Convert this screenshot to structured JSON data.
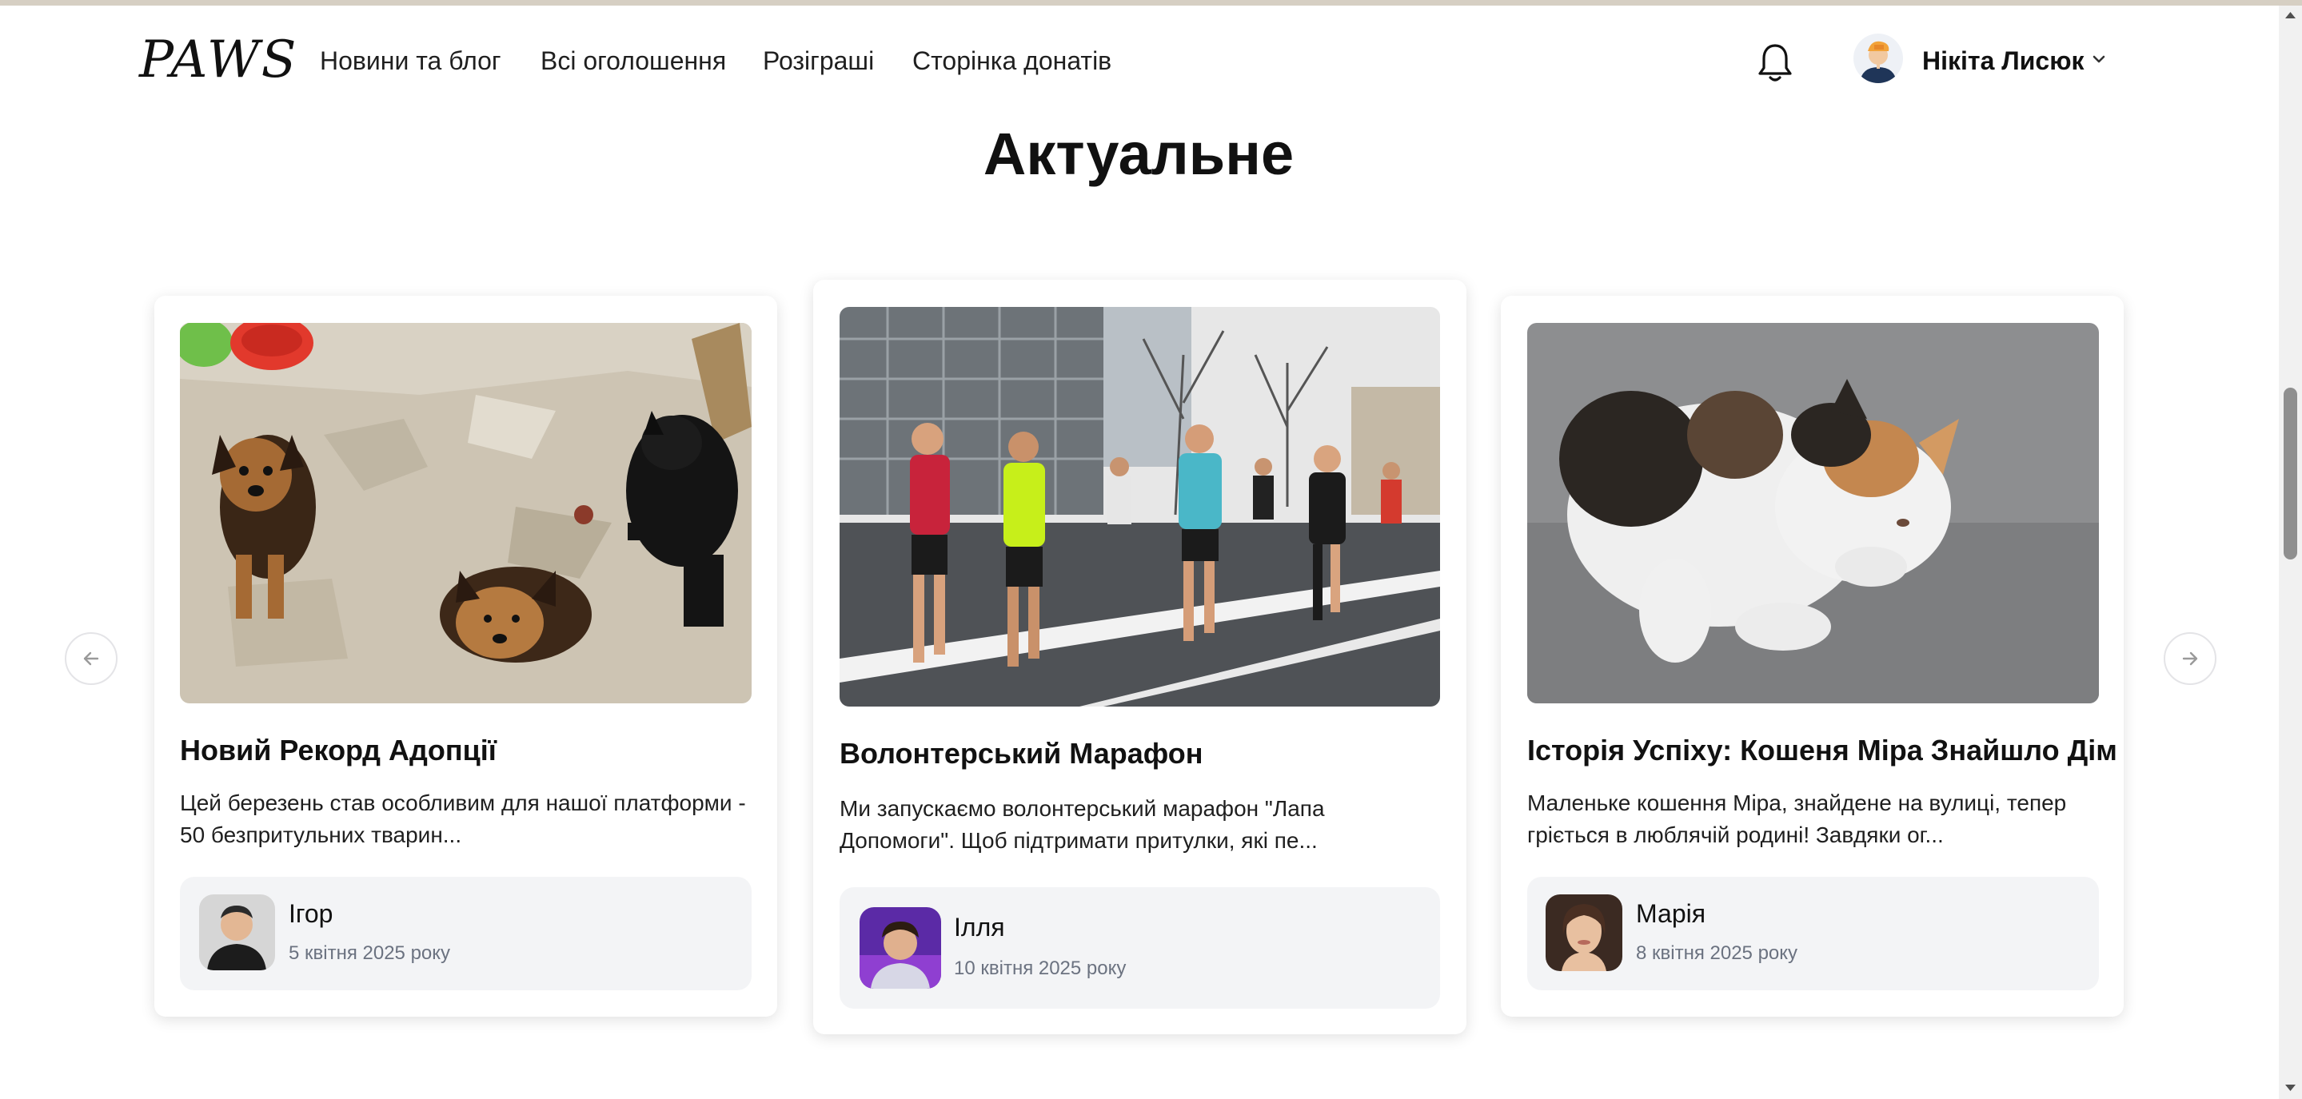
{
  "header": {
    "logo": "PAWS",
    "nav": [
      {
        "label": "Новини та блог"
      },
      {
        "label": "Всі оголошення"
      },
      {
        "label": "Розіграші"
      },
      {
        "label": "Сторінка донатів"
      }
    ],
    "user_name": "Нікіта Лисюк"
  },
  "section_title": "Актуальне",
  "cards": [
    {
      "title": "Новий Рекорд Адопції",
      "excerpt": "Цей березень став особливим для нашої платформи - 50 безпритульних тварин...",
      "author": "Ігор",
      "date": "5 квітня 2025 року",
      "image": "dogs-photo"
    },
    {
      "title": "Волонтерський Марафон",
      "excerpt": "Ми запускаємо волонтерський марафон \"Лапа Допомоги\". Щоб підтримати притулки, які пе...",
      "author": "Ілля",
      "date": "10 квітня 2025 року",
      "image": "marathon-photo"
    },
    {
      "title": "Історія Успіху: Кошеня Міра Знайшло Дім",
      "excerpt": "Маленьке кошення Міра, знайдене на вулиці, тепер гріється в люблячій родині! Завдяки ог...",
      "author": "Марія",
      "date": "8 квітня 2025 року",
      "image": "kitten-photo"
    }
  ],
  "icons": {
    "notifications": "bell-icon",
    "user_menu": "chevron-down-icon",
    "prev": "arrow-left-icon",
    "next": "arrow-right-icon"
  },
  "colors": {
    "text": "#111111",
    "muted": "#6b7280",
    "author_bg": "#f3f4f6",
    "scrollbar_thumb": "#8f8f8f"
  }
}
